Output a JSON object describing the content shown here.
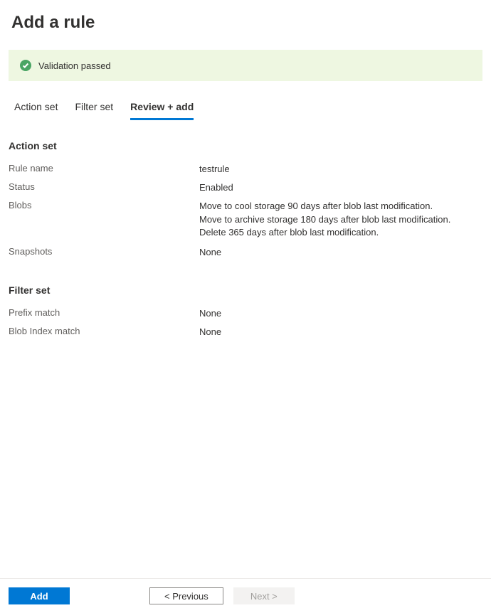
{
  "page_title": "Add a rule",
  "validation": {
    "message": "Validation passed"
  },
  "tabs": [
    {
      "label": "Action set",
      "active": false
    },
    {
      "label": "Filter set",
      "active": false
    },
    {
      "label": "Review + add",
      "active": true
    }
  ],
  "action_set": {
    "header": "Action set",
    "rows": {
      "rule_name": {
        "label": "Rule name",
        "value": "testrule"
      },
      "status": {
        "label": "Status",
        "value": "Enabled"
      },
      "blobs": {
        "label": "Blobs",
        "line1": "Move to cool storage 90 days after blob last modification.",
        "line2": "Move to archive storage 180 days after blob last modification.",
        "line3": "Delete 365 days after blob last modification."
      },
      "snapshots": {
        "label": "Snapshots",
        "value": "None"
      }
    }
  },
  "filter_set": {
    "header": "Filter set",
    "rows": {
      "prefix_match": {
        "label": "Prefix match",
        "value": "None"
      },
      "blob_index_match": {
        "label": "Blob Index match",
        "value": "None"
      }
    }
  },
  "footer": {
    "add": "Add",
    "previous": "<  Previous",
    "next": "Next  >"
  }
}
